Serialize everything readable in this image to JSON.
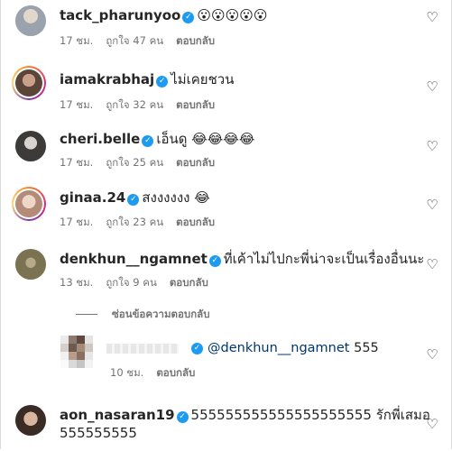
{
  "comments": [
    {
      "username": "tack_pharunyoo",
      "text": "😮😮😮😮😮",
      "time": "17 ชม.",
      "likes": "ถูกใจ 47 คน",
      "reply": "ตอบกลับ",
      "verified": true,
      "avatar_color": "#9aa3ad"
    },
    {
      "username": "iamakrabhaj",
      "text": "ไม่เคยชวน",
      "time": "17 ชม.",
      "likes": "ถูกใจ 32 คน",
      "reply": "ตอบกลับ",
      "verified": true,
      "avatar_color": "#6b5446"
    },
    {
      "username": "cheri.belle",
      "text": "เอ็นดู 😂😂😂😂",
      "time": "17 ชม.",
      "likes": "ถูกใจ 25 คน",
      "reply": "ตอบกลับ",
      "verified": true,
      "avatar_color": "#3d3b3a"
    },
    {
      "username": "ginaa.24",
      "text": "สงงงงงง 😂",
      "time": "17 ชม.",
      "likes": "ถูกใจ 23 คน",
      "reply": "ตอบกลับ",
      "verified": true,
      "avatar_color": "#d9b6a6"
    },
    {
      "username": "denkhun__ngamnet",
      "text": "ที่เค้าไม่ไปกะพี่น่าจะเป็นเรื่องอื่นนะ",
      "time": "13 ชม.",
      "likes": "ถูกใจ 9 คน",
      "reply": "ตอบกลับ",
      "verified": true,
      "avatar_color": "#7a7250"
    }
  ],
  "view_replies": "ซ่อนข้อความตอบกลับ",
  "reply_comment": {
    "mention": "@denkhun__ngamnet",
    "text": " 555",
    "time": "10 ชม.",
    "reply": "ตอบกลับ"
  },
  "last_comment": {
    "username": "aon_nasaran19",
    "text": "555555555555555555555 รักพี่เสมอ",
    "text2": "555555555",
    "verified": true,
    "avatar_color": "#5a4a44"
  },
  "colors": {
    "verified": "#1d9bf0",
    "secondary_text": "#737373",
    "text": "#262626"
  },
  "icons": {
    "like": "heart-outline-icon",
    "verified": "verified-badge-icon"
  }
}
